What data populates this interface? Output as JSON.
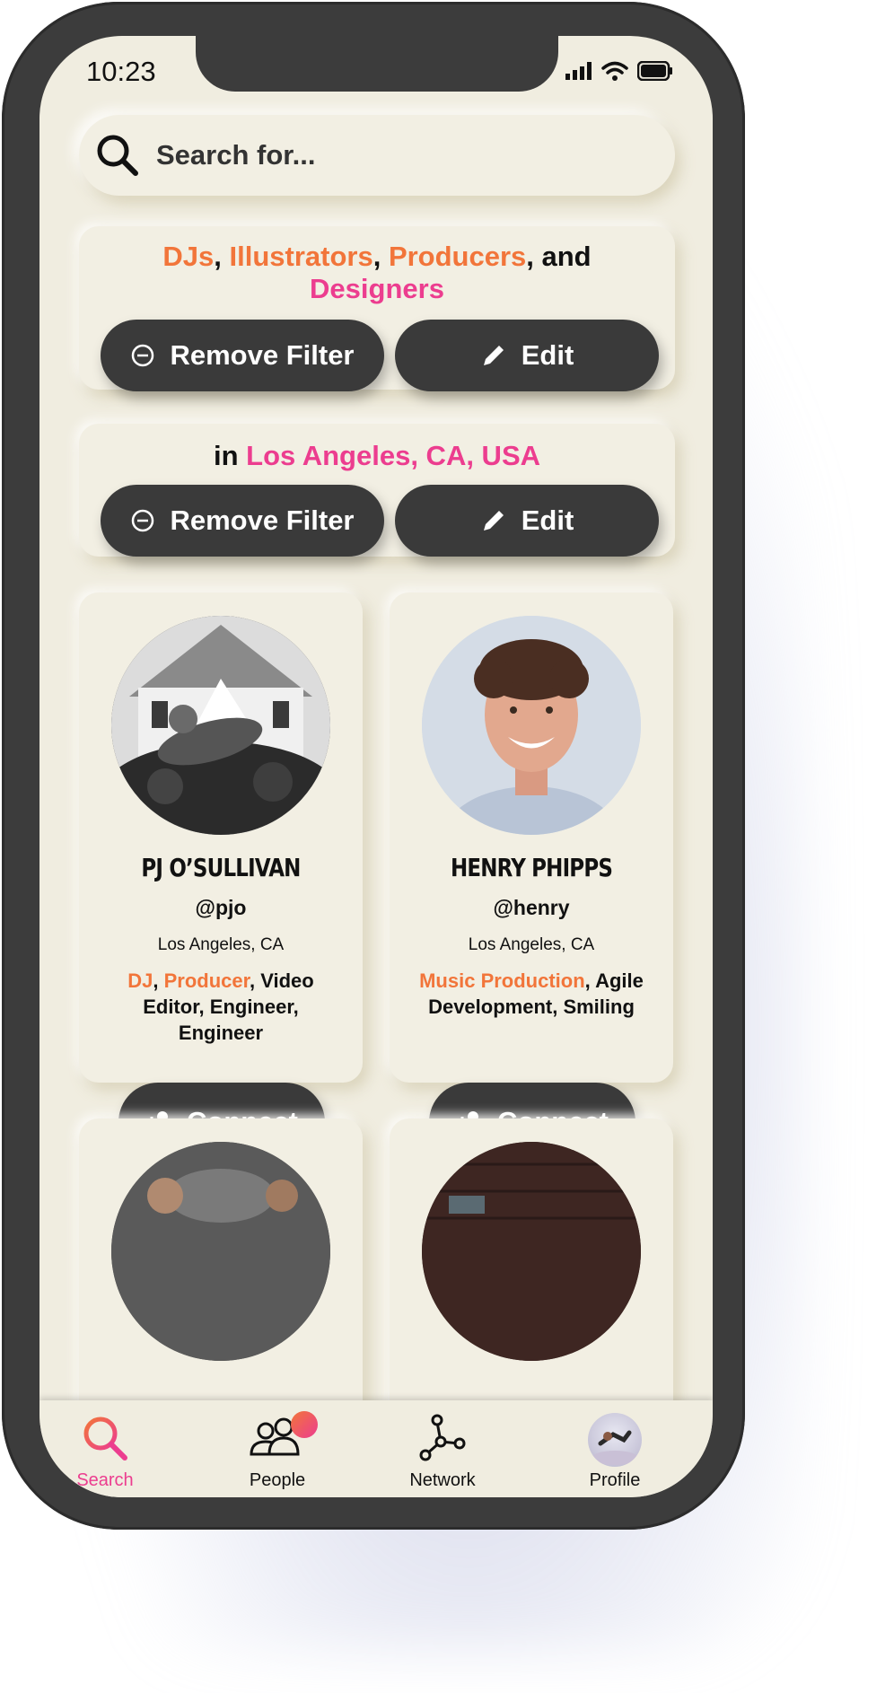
{
  "status_bar": {
    "time": "10:23"
  },
  "search": {
    "placeholder": "Search for..."
  },
  "filters": [
    {
      "parts": [
        {
          "text": "DJs",
          "color": "orange"
        },
        {
          "text": ", ",
          "color": "black"
        },
        {
          "text": "Illustrators",
          "color": "orange"
        },
        {
          "text": ", ",
          "color": "black"
        },
        {
          "text": "Producers",
          "color": "orange"
        },
        {
          "text": ", and",
          "color": "black"
        },
        {
          "text": "Designers",
          "color": "pink"
        }
      ],
      "remove_label": "Remove Filter",
      "edit_label": "Edit"
    },
    {
      "parts": [
        {
          "text": "in ",
          "color": "black"
        },
        {
          "text": "Los Angeles, CA, USA",
          "color": "pink"
        }
      ],
      "remove_label": "Remove Filter",
      "edit_label": "Edit"
    }
  ],
  "profiles": [
    {
      "name": "PJ O’SULLIVAN",
      "handle": "@pjo",
      "location": "Los Angeles, CA",
      "skills": [
        {
          "text": "DJ",
          "highlight": true
        },
        {
          "text": ", ",
          "highlight": false
        },
        {
          "text": "Producer",
          "highlight": true
        },
        {
          "text": ", Video Editor, Engineer, Engineer",
          "highlight": false
        }
      ],
      "connect_label": "Connect"
    },
    {
      "name": "HENRY PHIPPS",
      "handle": "@henry",
      "location": "Los Angeles, CA",
      "skills": [
        {
          "text": "Music Production",
          "highlight": true
        },
        {
          "text": ", Agile Development, Smiling",
          "highlight": false
        }
      ],
      "connect_label": "Connect"
    }
  ],
  "tabbar": {
    "search": "Search",
    "people": "People",
    "network": "Network",
    "profile": "Profile"
  },
  "colors": {
    "orange": "#f2753a",
    "pink": "#ec3d8f",
    "screen_bg": "#f0ede0",
    "button_dark": "#3a3a3a"
  }
}
